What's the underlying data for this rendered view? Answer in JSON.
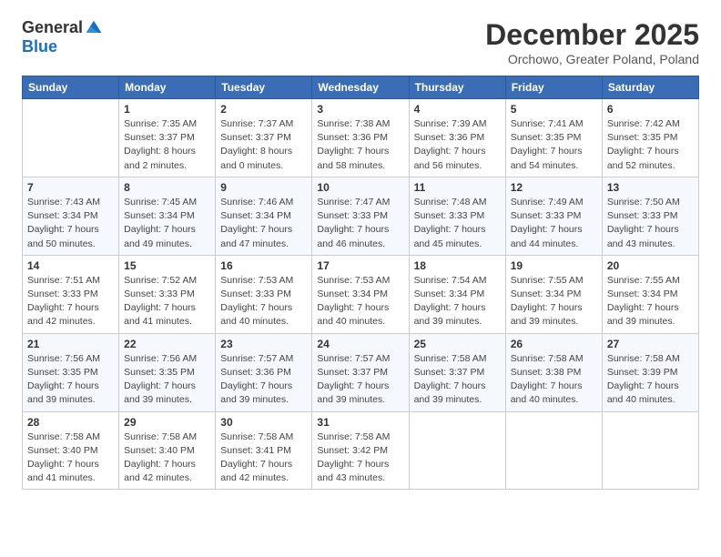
{
  "header": {
    "logo_general": "General",
    "logo_blue": "Blue",
    "month_title": "December 2025",
    "location": "Orchowo, Greater Poland, Poland"
  },
  "days_of_week": [
    "Sunday",
    "Monday",
    "Tuesday",
    "Wednesday",
    "Thursday",
    "Friday",
    "Saturday"
  ],
  "weeks": [
    [
      {
        "day": "",
        "info": ""
      },
      {
        "day": "1",
        "info": "Sunrise: 7:35 AM\nSunset: 3:37 PM\nDaylight: 8 hours\nand 2 minutes."
      },
      {
        "day": "2",
        "info": "Sunrise: 7:37 AM\nSunset: 3:37 PM\nDaylight: 8 hours\nand 0 minutes."
      },
      {
        "day": "3",
        "info": "Sunrise: 7:38 AM\nSunset: 3:36 PM\nDaylight: 7 hours\nand 58 minutes."
      },
      {
        "day": "4",
        "info": "Sunrise: 7:39 AM\nSunset: 3:36 PM\nDaylight: 7 hours\nand 56 minutes."
      },
      {
        "day": "5",
        "info": "Sunrise: 7:41 AM\nSunset: 3:35 PM\nDaylight: 7 hours\nand 54 minutes."
      },
      {
        "day": "6",
        "info": "Sunrise: 7:42 AM\nSunset: 3:35 PM\nDaylight: 7 hours\nand 52 minutes."
      }
    ],
    [
      {
        "day": "7",
        "info": "Sunrise: 7:43 AM\nSunset: 3:34 PM\nDaylight: 7 hours\nand 50 minutes."
      },
      {
        "day": "8",
        "info": "Sunrise: 7:45 AM\nSunset: 3:34 PM\nDaylight: 7 hours\nand 49 minutes."
      },
      {
        "day": "9",
        "info": "Sunrise: 7:46 AM\nSunset: 3:34 PM\nDaylight: 7 hours\nand 47 minutes."
      },
      {
        "day": "10",
        "info": "Sunrise: 7:47 AM\nSunset: 3:33 PM\nDaylight: 7 hours\nand 46 minutes."
      },
      {
        "day": "11",
        "info": "Sunrise: 7:48 AM\nSunset: 3:33 PM\nDaylight: 7 hours\nand 45 minutes."
      },
      {
        "day": "12",
        "info": "Sunrise: 7:49 AM\nSunset: 3:33 PM\nDaylight: 7 hours\nand 44 minutes."
      },
      {
        "day": "13",
        "info": "Sunrise: 7:50 AM\nSunset: 3:33 PM\nDaylight: 7 hours\nand 43 minutes."
      }
    ],
    [
      {
        "day": "14",
        "info": "Sunrise: 7:51 AM\nSunset: 3:33 PM\nDaylight: 7 hours\nand 42 minutes."
      },
      {
        "day": "15",
        "info": "Sunrise: 7:52 AM\nSunset: 3:33 PM\nDaylight: 7 hours\nand 41 minutes."
      },
      {
        "day": "16",
        "info": "Sunrise: 7:53 AM\nSunset: 3:33 PM\nDaylight: 7 hours\nand 40 minutes."
      },
      {
        "day": "17",
        "info": "Sunrise: 7:53 AM\nSunset: 3:34 PM\nDaylight: 7 hours\nand 40 minutes."
      },
      {
        "day": "18",
        "info": "Sunrise: 7:54 AM\nSunset: 3:34 PM\nDaylight: 7 hours\nand 39 minutes."
      },
      {
        "day": "19",
        "info": "Sunrise: 7:55 AM\nSunset: 3:34 PM\nDaylight: 7 hours\nand 39 minutes."
      },
      {
        "day": "20",
        "info": "Sunrise: 7:55 AM\nSunset: 3:34 PM\nDaylight: 7 hours\nand 39 minutes."
      }
    ],
    [
      {
        "day": "21",
        "info": "Sunrise: 7:56 AM\nSunset: 3:35 PM\nDaylight: 7 hours\nand 39 minutes."
      },
      {
        "day": "22",
        "info": "Sunrise: 7:56 AM\nSunset: 3:35 PM\nDaylight: 7 hours\nand 39 minutes."
      },
      {
        "day": "23",
        "info": "Sunrise: 7:57 AM\nSunset: 3:36 PM\nDaylight: 7 hours\nand 39 minutes."
      },
      {
        "day": "24",
        "info": "Sunrise: 7:57 AM\nSunset: 3:37 PM\nDaylight: 7 hours\nand 39 minutes."
      },
      {
        "day": "25",
        "info": "Sunrise: 7:58 AM\nSunset: 3:37 PM\nDaylight: 7 hours\nand 39 minutes."
      },
      {
        "day": "26",
        "info": "Sunrise: 7:58 AM\nSunset: 3:38 PM\nDaylight: 7 hours\nand 40 minutes."
      },
      {
        "day": "27",
        "info": "Sunrise: 7:58 AM\nSunset: 3:39 PM\nDaylight: 7 hours\nand 40 minutes."
      }
    ],
    [
      {
        "day": "28",
        "info": "Sunrise: 7:58 AM\nSunset: 3:40 PM\nDaylight: 7 hours\nand 41 minutes."
      },
      {
        "day": "29",
        "info": "Sunrise: 7:58 AM\nSunset: 3:40 PM\nDaylight: 7 hours\nand 42 minutes."
      },
      {
        "day": "30",
        "info": "Sunrise: 7:58 AM\nSunset: 3:41 PM\nDaylight: 7 hours\nand 42 minutes."
      },
      {
        "day": "31",
        "info": "Sunrise: 7:58 AM\nSunset: 3:42 PM\nDaylight: 7 hours\nand 43 minutes."
      },
      {
        "day": "",
        "info": ""
      },
      {
        "day": "",
        "info": ""
      },
      {
        "day": "",
        "info": ""
      }
    ]
  ]
}
